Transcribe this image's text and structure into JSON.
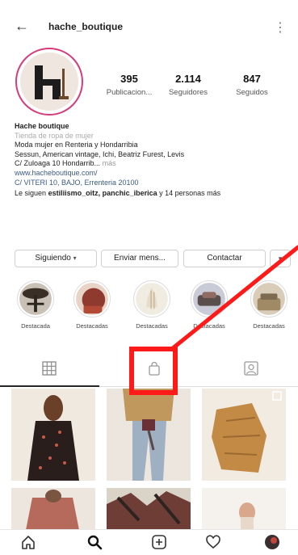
{
  "header": {
    "username": "hache_boutique",
    "back_icon": "back-arrow-icon",
    "menu_icon": "more-vertical-icon"
  },
  "stats": [
    {
      "value": "395",
      "label": "Publicacion..."
    },
    {
      "value": "2.114",
      "label": "Seguidores"
    },
    {
      "value": "847",
      "label": "Seguidos"
    }
  ],
  "bio": {
    "name": "Hache boutique",
    "category": "Tienda de ropa de mujer",
    "lines": [
      "Moda mujer en Renteria y Hondarribia",
      "Sessun, American vintage, Ichi, Beatriz Furest, Levis",
      "C/ Zuloaga 10 Hondarrib..."
    ],
    "more_label": "más",
    "link": "www.hacheboutique.com/",
    "address": "C/ VITERI 10, BAJO, Errenteria 20100",
    "followed_prefix": "Le siguen",
    "followed_names": "estiliismo_oitz, panchic_iberica",
    "followed_suffix": "y 14 personas más"
  },
  "actions": {
    "following": "Siguiendo",
    "message": "Enviar mens...",
    "contact": "Contactar",
    "chevron_icon": "chevron-down-icon"
  },
  "highlights": [
    {
      "label": "Destacada"
    },
    {
      "label": "Destacadas"
    },
    {
      "label": "Destacadas"
    },
    {
      "label": "Destacadas"
    },
    {
      "label": "Destacadas"
    }
  ],
  "tabs": [
    {
      "name": "grid",
      "icon": "grid-icon",
      "active": true
    },
    {
      "name": "shop",
      "icon": "shopping-bag-icon",
      "active": false
    },
    {
      "name": "tagged",
      "icon": "tagged-person-icon",
      "active": false
    }
  ],
  "nav": [
    "home-icon",
    "search-icon",
    "add-post-icon",
    "heart-icon",
    "profile-avatar-icon"
  ],
  "colors": {
    "annotation": "#ff1a1a",
    "story_ring": "#d63c7b",
    "link": "#3a5b84"
  }
}
